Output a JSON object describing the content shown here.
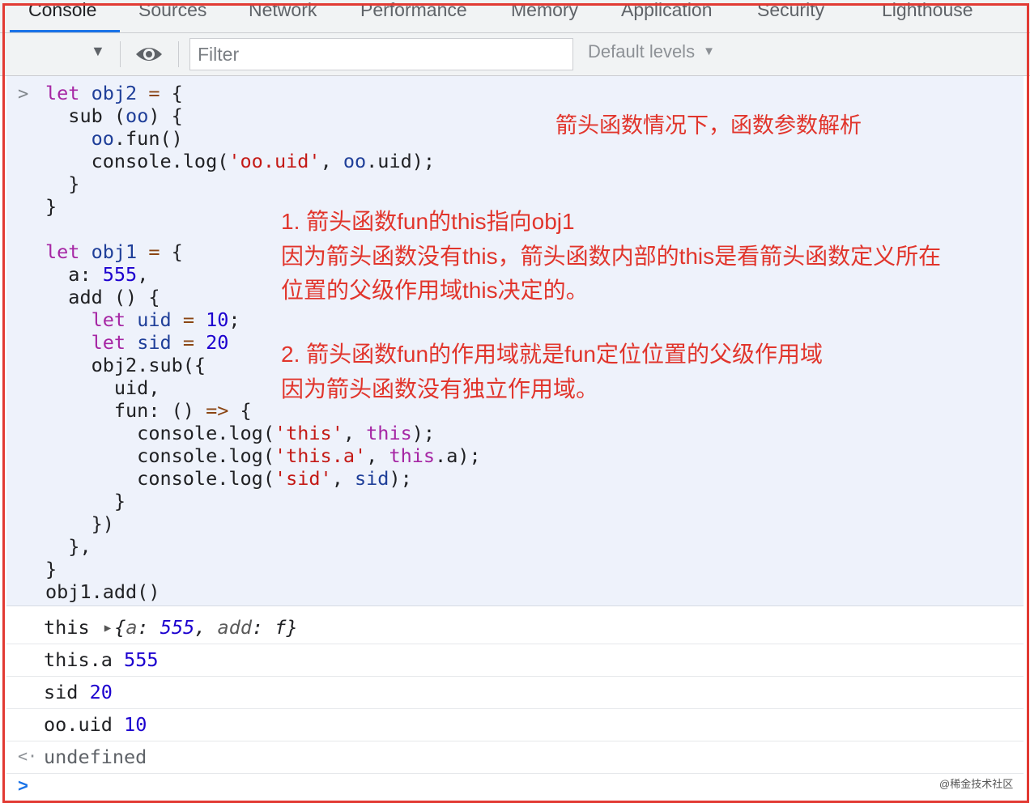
{
  "tabs": [
    {
      "label": "Console",
      "active": true
    },
    {
      "label": "Sources"
    },
    {
      "label": "Network"
    },
    {
      "label": "Performance"
    },
    {
      "label": "Memory"
    },
    {
      "label": "Application"
    },
    {
      "label": "Security"
    },
    {
      "label": "Lighthouse"
    }
  ],
  "toolbar": {
    "filter_placeholder": "Filter",
    "levels_label": "Default levels"
  },
  "annotations": {
    "title": "箭头函数情况下，函数参数解析",
    "note1_line1": "1. 箭头函数fun的this指向obj1",
    "note1_line2": "因为箭头函数没有this，箭头函数内部的this是看箭头函数定义所在",
    "note1_line3": "位置的父级作用域this决定的。",
    "note2_line1": "2. 箭头函数fun的作用域就是fun定位位置的父级作用域",
    "note2_line2": "因为箭头函数没有独立作用域。"
  },
  "output": {
    "row1": {
      "label": "this",
      "obj_open": "{",
      "k1": "a",
      "v1": "555",
      "k2": "add",
      "v2": "f",
      "obj_close": "}"
    },
    "row2": {
      "label": "this.a",
      "value": "555"
    },
    "row3": {
      "label": "sid",
      "value": "20"
    },
    "row4": {
      "label": "oo.uid",
      "value": "10"
    },
    "return_value": "undefined"
  },
  "watermark": "@稀金技术社区",
  "colors": {
    "annotation": "#e1352c",
    "accent": "#1a73e8"
  }
}
